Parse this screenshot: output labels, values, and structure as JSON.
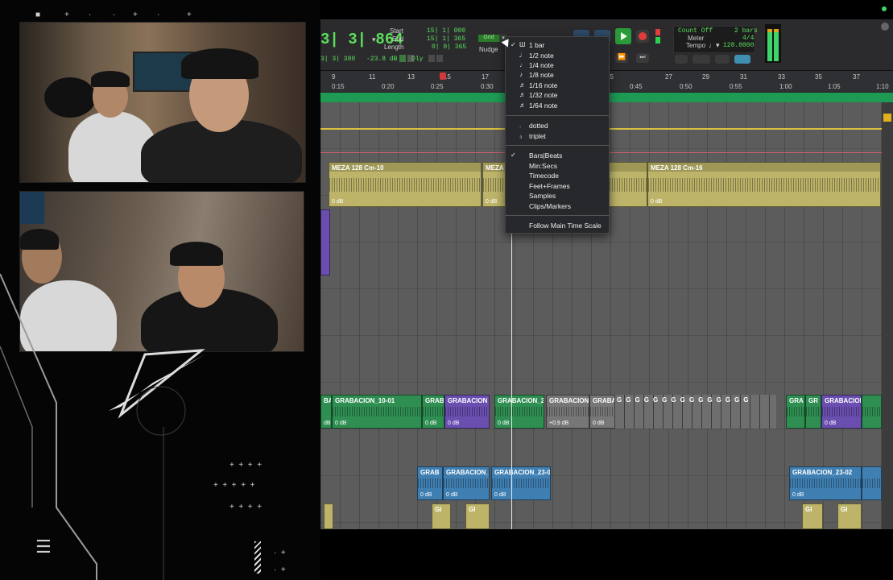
{
  "toolbar": {
    "main_counter": "3| 3| 864",
    "sub_counter": "3| 3| 380",
    "start_label": "Start",
    "end_label": "End",
    "length_label": "Length",
    "start_value": "15| 1| 000",
    "end_value": "15| 1| 365",
    "length_value": "0| 0| 365",
    "db_readout": "-23.8 dB",
    "dly_label": "Dly",
    "grid_label": "Grid",
    "nudge_label": "Nudge",
    "count_off_label": "Count Off",
    "count_off_value": "2 bars",
    "meter_label": "Meter",
    "meter_value": "4/4",
    "tempo_label": "Tempo",
    "tempo_value": "128.0000"
  },
  "ruler": {
    "bars": [
      "9",
      "11",
      "13",
      "15",
      "17",
      "25",
      "27",
      "29",
      "31",
      "33",
      "35",
      "37"
    ],
    "times": [
      "0:15",
      "0:20",
      "0:25",
      "0:30",
      "0:45",
      "0:50",
      "0:55",
      "1:00",
      "1:05",
      "1:10"
    ]
  },
  "grid_menu": {
    "note_items": [
      {
        "label": "1 bar",
        "checked": true
      },
      {
        "label": "1/2 note",
        "checked": false
      },
      {
        "label": "1/4 note",
        "checked": false
      },
      {
        "label": "1/8 note",
        "checked": false
      },
      {
        "label": "1/16 note",
        "checked": false
      },
      {
        "label": "1/32 note",
        "checked": false
      },
      {
        "label": "1/64 note",
        "checked": false
      }
    ],
    "modifiers": [
      "dotted",
      "triplet"
    ],
    "scales": [
      {
        "label": "Bars|Beats",
        "checked": true
      },
      {
        "label": "Min:Secs",
        "checked": false
      },
      {
        "label": "Timecode",
        "checked": false
      },
      {
        "label": "Feet+Frames",
        "checked": false
      },
      {
        "label": "Samples",
        "checked": false
      },
      {
        "label": "Clips/Markers",
        "checked": false
      }
    ],
    "follow": "Follow Main Time Scale"
  },
  "clips": {
    "meza_a": "MEZA 128 Cm-10",
    "meza_b": "MEZA",
    "meza_c": "MEZA 128 Cm-16",
    "meza_gain": "0 dB",
    "grab_partial": "BA",
    "grab_10_01": "GRABACION_10-01",
    "grab_short": "GRAB",
    "grabacion": "GRABACION",
    "grab_22": "GRABACION_2",
    "grabacion_trunc": "GRABACION_",
    "graba": "GRABA(",
    "g_small": "G",
    "gra": "GRA",
    "gr": "GR",
    "grabacion_i": "GRABACIOI",
    "grab_23": "GRABACION_23-0",
    "grab_23_02": "GRABACION_23-02",
    "gi": "GI",
    "gain_0": "0 dB",
    "gain_09": "+0.9 dB",
    "db_short": "dB"
  },
  "colors": {
    "counter_green": "#5be05b",
    "timeline_green": "#1e9a55",
    "clip_yellow": "#bdb46a",
    "clip_green": "#2f8f52",
    "clip_purple": "#6a4fb0",
    "clip_blue": "#3f7fb2"
  }
}
